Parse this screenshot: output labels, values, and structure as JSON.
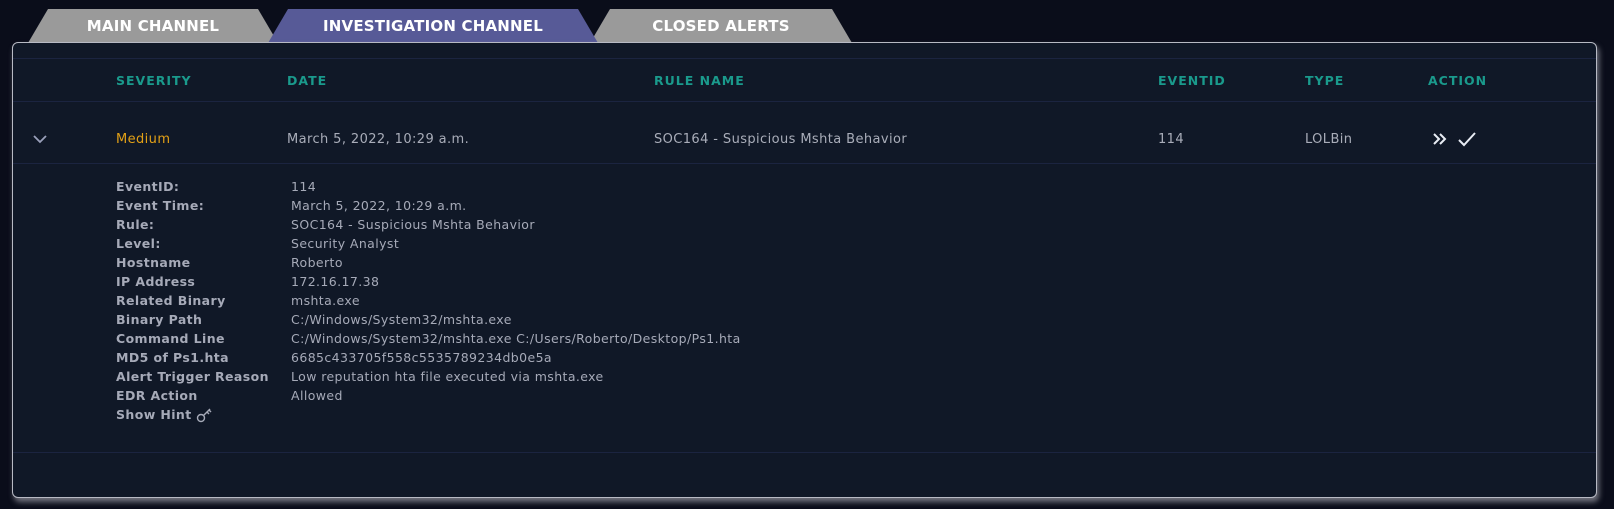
{
  "tabs": [
    {
      "label": "MAIN CHANNEL",
      "active": false
    },
    {
      "label": "INVESTIGATION CHANNEL",
      "active": true
    },
    {
      "label": "CLOSED ALERTS",
      "active": false
    }
  ],
  "table": {
    "headers": {
      "severity": "SEVERITY",
      "date": "DATE",
      "rule_name": "RULE NAME",
      "eventid": "EVENTID",
      "type": "TYPE",
      "action": "ACTION"
    },
    "rows": [
      {
        "severity": "Medium",
        "date": "March 5, 2022, 10:29 a.m.",
        "rule_name": "SOC164 - Suspicious Mshta Behavior",
        "eventid": "114",
        "type": "LOLBin",
        "actions": [
          "take-ownership-icon",
          "check-icon"
        ],
        "expanded": true
      }
    ]
  },
  "details": {
    "fields": [
      {
        "key": "EventID:",
        "value": "114"
      },
      {
        "key": "Event Time:",
        "value": "March 5, 2022, 10:29 a.m."
      },
      {
        "key": "Rule:",
        "value": "SOC164 - Suspicious Mshta Behavior"
      },
      {
        "key": "Level:",
        "value": "Security Analyst"
      },
      {
        "key": "Hostname",
        "value": "Roberto"
      },
      {
        "key": "IP Address",
        "value": "172.16.17.38"
      },
      {
        "key": "Related Binary",
        "value": "mshta.exe"
      },
      {
        "key": "Binary Path",
        "value": "C:/Windows/System32/mshta.exe"
      },
      {
        "key": "Command Line",
        "value": "C:/Windows/System32/mshta.exe C:/Users/Roberto/Desktop/Ps1.hta"
      },
      {
        "key": "MD5 of Ps1.hta",
        "value": "6685c433705f558c5535789234db0e5a"
      },
      {
        "key": "Alert Trigger Reason",
        "value": "Low reputation hta file executed via mshta.exe"
      },
      {
        "key": "EDR Action",
        "value": "Allowed"
      }
    ],
    "show_hint_label": "Show Hint"
  },
  "colors": {
    "header_teal": "#1a9a8c",
    "severity_medium": "#e2a016",
    "tab_active": "#575a97",
    "tab_inactive": "#9a9a9a",
    "panel_bg": "#101827"
  }
}
